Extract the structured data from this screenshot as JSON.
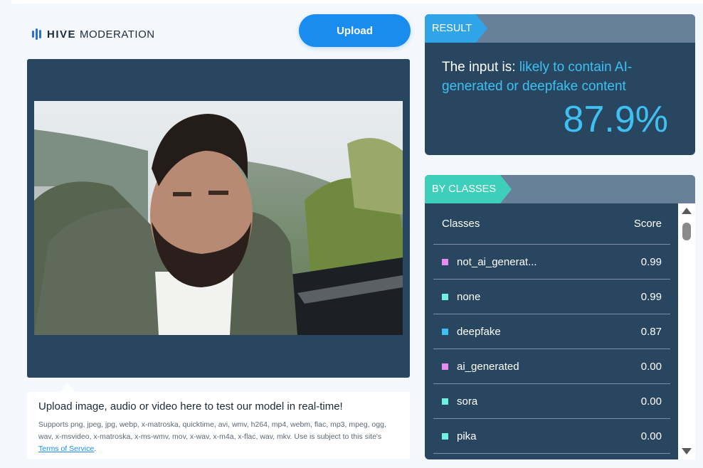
{
  "brand": {
    "word1": "HIVE",
    "word2": "MODERATION"
  },
  "upload_button": "Upload",
  "hint": {
    "title": "Upload image, audio or video here to test our model in real-time!",
    "text": "Supports png, jpeg, jpg, webp, x-matroska, quicktime, avi, wmv, h264, mp4, webm, flac, mp3, mpeg, ogg, wav, x-msvideo, x-matroska, x-ms-wmv, mov, x-wav, x-m4a, x-flac, wav, mkv. Use is subject to this site's ",
    "link": "Terms of Service",
    "end": "."
  },
  "result": {
    "tag": "RESULT",
    "prefix": "The input is: ",
    "verdict": "likely to contain AI-generated or deepfake content",
    "score": "87.9%"
  },
  "classes": {
    "tag": "BY CLASSES",
    "col_class": "Classes",
    "col_score": "Score",
    "rows": [
      {
        "name": "not_ai_generat...",
        "score": "0.99",
        "color": "#e58cf0"
      },
      {
        "name": "none",
        "score": "0.99",
        "color": "#6ff0e0"
      },
      {
        "name": "deepfake",
        "score": "0.87",
        "color": "#3ec0f2"
      },
      {
        "name": "ai_generated",
        "score": "0.00",
        "color": "#e58cf0"
      },
      {
        "name": "sora",
        "score": "0.00",
        "color": "#6ff0e0"
      },
      {
        "name": "pika",
        "score": "0.00",
        "color": "#6ff0e0"
      }
    ]
  },
  "colors": {
    "panel": "#284660",
    "accent_blue": "#1a8cf0",
    "result_tag": "#2fa4e6",
    "classes_tag": "#3ecfba",
    "verdict": "#3ec0f2"
  }
}
